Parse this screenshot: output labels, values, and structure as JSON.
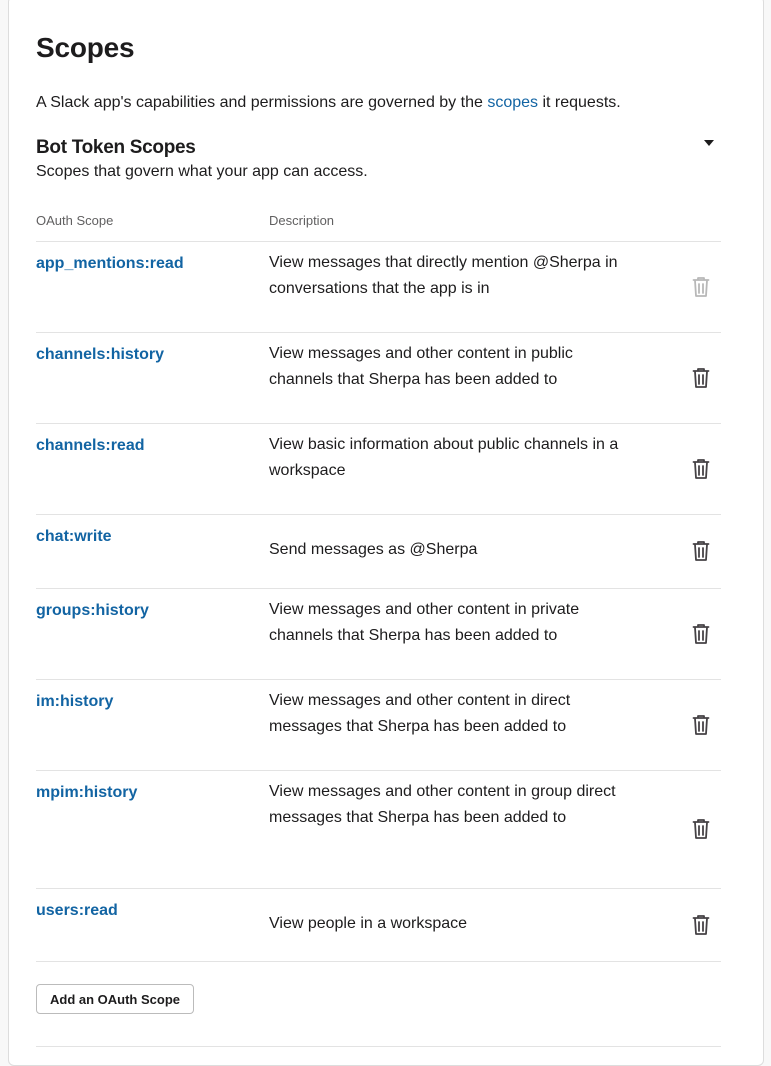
{
  "section": {
    "title": "Scopes",
    "intro_before": "A Slack app's capabilities and permissions are governed by the ",
    "intro_link": "scopes",
    "intro_after": " it requests."
  },
  "bot_scopes": {
    "title": "Bot Token Scopes",
    "subtitle": "Scopes that govern what your app can access.",
    "headers": {
      "scope": "OAuth Scope",
      "description": "Description"
    },
    "rows": [
      {
        "scope": "app_mentions:read",
        "description": "View messages that directly mention @Sherpa in conversations that the app is in",
        "removable": false
      },
      {
        "scope": "channels:history",
        "description": "View messages and other content in public channels that Sherpa has been added to",
        "removable": true
      },
      {
        "scope": "channels:read",
        "description": "View basic information about public channels in a workspace",
        "removable": true
      },
      {
        "scope": "chat:write",
        "description": "Send messages as @Sherpa",
        "removable": true
      },
      {
        "scope": "groups:history",
        "description": "View messages and other content in private channels that Sherpa has been added to",
        "removable": true
      },
      {
        "scope": "im:history",
        "description": "View messages and other content in direct messages that Sherpa has been added to",
        "removable": true
      },
      {
        "scope": "mpim:history",
        "description": "View messages and other content in group direct messages that Sherpa has been added to",
        "removable": true
      },
      {
        "scope": "users:read",
        "description": "View people in a workspace",
        "removable": true
      }
    ],
    "add_button": "Add an OAuth Scope"
  },
  "icons": {
    "collapse": "caret-down-icon",
    "remove": "trash-icon"
  },
  "colors": {
    "link": "#1264a3",
    "trash": "#454245",
    "trash_disabled": "#b8b8b8"
  }
}
